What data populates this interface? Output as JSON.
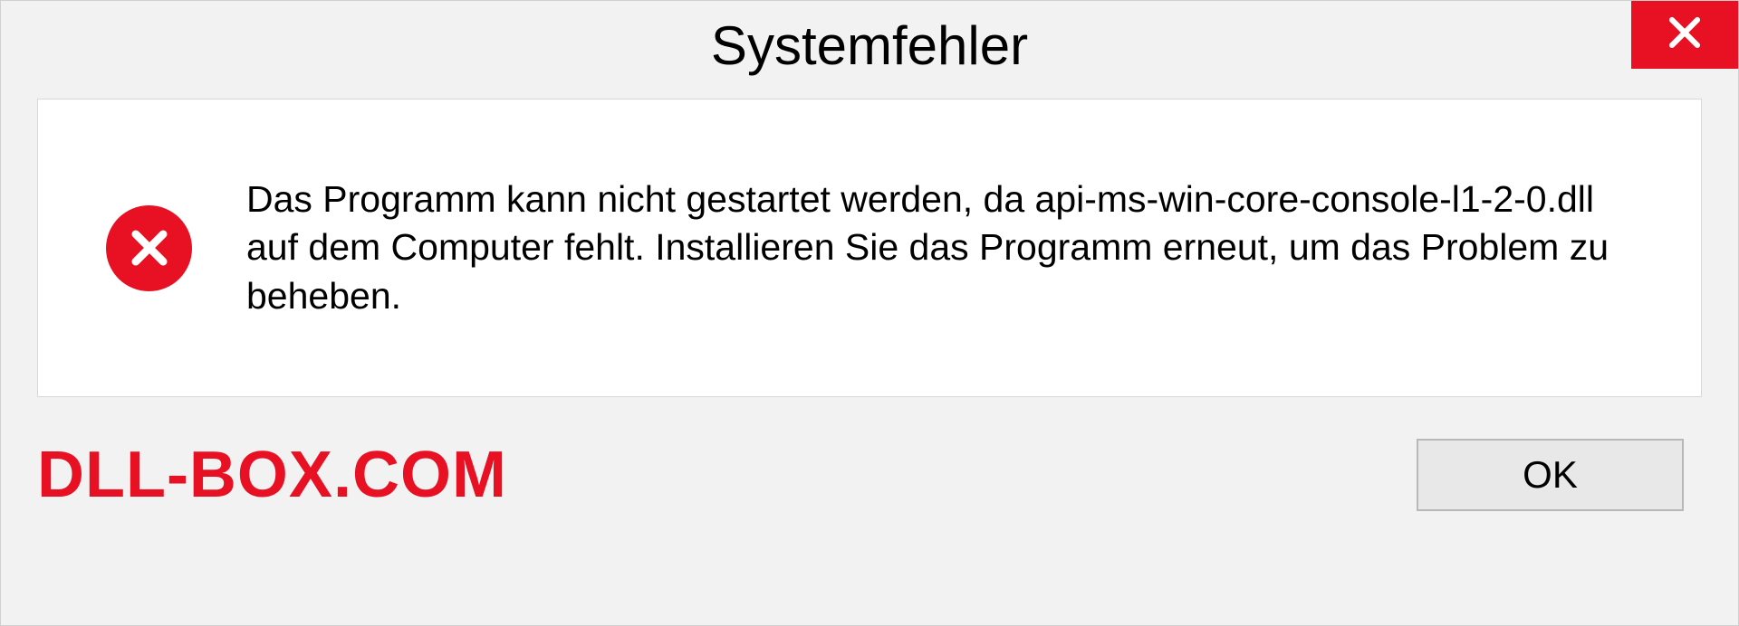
{
  "dialog": {
    "title": "Systemfehler",
    "message": "Das Programm kann nicht gestartet werden, da api-ms-win-core-console-l1-2-0.dll auf dem Computer fehlt. Installieren Sie das Programm erneut, um das Problem zu beheben.",
    "ok_label": "OK"
  },
  "watermark": "DLL-BOX.COM",
  "colors": {
    "accent_red": "#e81123",
    "background": "#f2f2f2",
    "panel": "#ffffff"
  }
}
